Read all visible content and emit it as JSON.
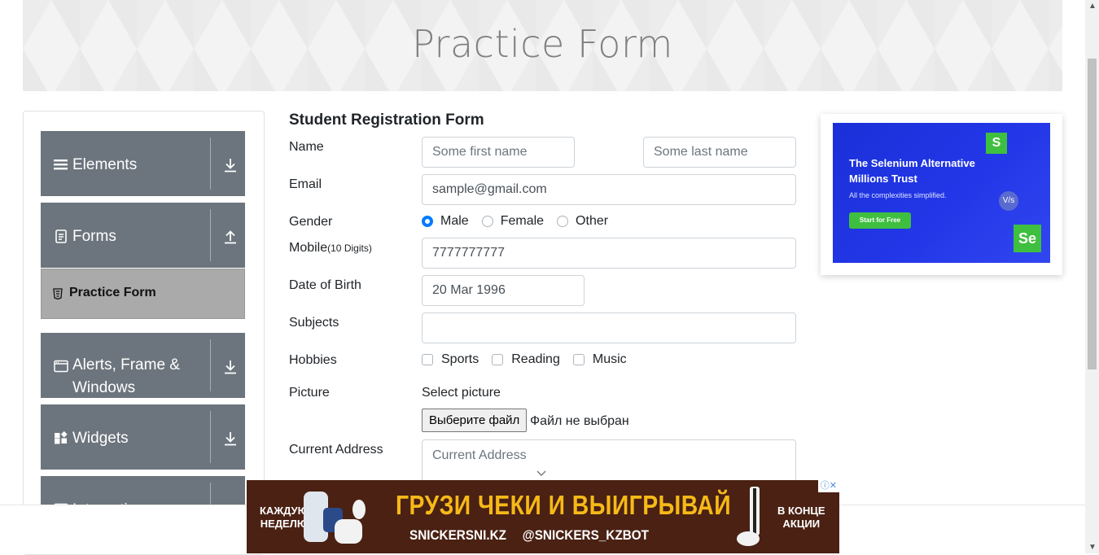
{
  "page": {
    "title": "Practice Form"
  },
  "sidebar": {
    "groups": [
      {
        "label": "Elements",
        "icon": "hamburger-icon",
        "arrow": "download-arrow-icon"
      },
      {
        "label": "Forms",
        "icon": "document-icon",
        "arrow": "upload-arrow-icon"
      },
      {
        "label": "Alerts, Frame & Windows",
        "icon": "window-icon",
        "arrow": "download-arrow-icon"
      },
      {
        "label": "Widgets",
        "icon": "widgets-icon",
        "arrow": "download-arrow-icon"
      },
      {
        "label": "Interactions",
        "icon": "interactions-icon",
        "arrow": "download-arrow-icon"
      }
    ],
    "active_item": {
      "label": "Practice Form",
      "icon": "html5-icon"
    }
  },
  "form": {
    "heading": "Student Registration Form",
    "name": {
      "label": "Name",
      "first_placeholder": "Some first name",
      "last_placeholder": "Some last name"
    },
    "email": {
      "label": "Email",
      "value": "sample@gmail.com"
    },
    "gender": {
      "label": "Gender",
      "options": [
        "Male",
        "Female",
        "Other"
      ],
      "selected": "Male"
    },
    "mobile": {
      "label": "Mobile",
      "hint": "(10 Digits)",
      "value": "7777777777"
    },
    "dob": {
      "label": "Date of Birth",
      "value": "20 Mar 1996"
    },
    "subjects": {
      "label": "Subjects",
      "value": ""
    },
    "hobbies": {
      "label": "Hobbies",
      "options": [
        "Sports",
        "Reading",
        "Music"
      ]
    },
    "picture": {
      "label": "Picture",
      "select_label": "Select picture",
      "button_label": "Выберите файл",
      "status": "Файл не выбран"
    },
    "address": {
      "label": "Current Address",
      "placeholder": "Current Address"
    }
  },
  "right_ad": {
    "title": "The Selenium Alternative Millions Trust",
    "subtitle": "All the complexities simplified.",
    "button": "Start for Free",
    "badge_top": "S",
    "badge_vs": "V/s",
    "badge_bottom": "Se",
    "colors": {
      "background": "#2337e8",
      "accent": "#3fbf3f"
    }
  },
  "bottom_ad": {
    "left_text_1": "КАЖДУЮ",
    "left_text_2": "НЕДЕЛЮ",
    "headline": "ГРУЗИ ЧЕКИ И ВЫИГРЫВАЙ",
    "site": "SNICKERSNI.KZ",
    "telegram": "@SNICKERS_KZBOT",
    "right_text_1": "В КОНЦЕ",
    "right_text_2": "АКЦИИ",
    "close_glyphs": "ⓘ✕",
    "colors": {
      "background": "#4a2113",
      "headline": "#f6b918"
    }
  }
}
